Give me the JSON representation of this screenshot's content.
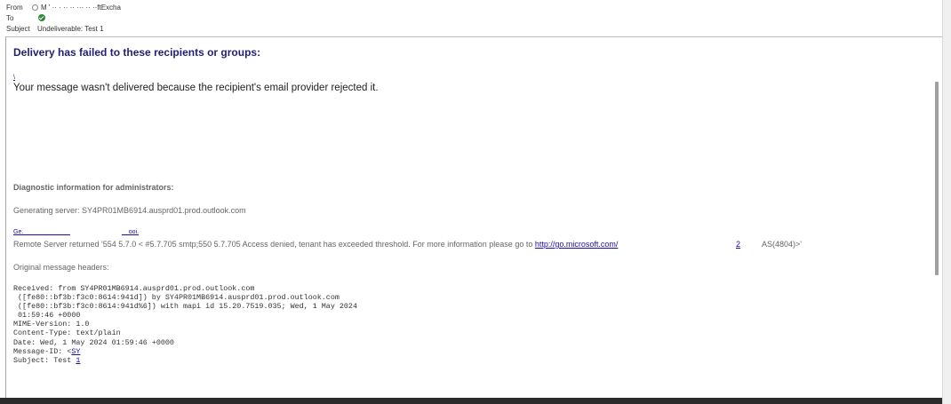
{
  "header": {
    "from_label": "From",
    "from_value": "M ' ·· · ·· ·· ··· ·· ··ftExcha",
    "to_label": "To",
    "subject_label": "Subject",
    "subject_value": "Undeliverable: Test 1"
  },
  "body": {
    "headline": "Delivery has failed to these recipients or groups:",
    "tiny_link": "\\",
    "message": "Your message wasn't delivered because the recipient's email provider rejected it.",
    "diag_title": "Diagnostic information for administrators:",
    "generating_server": "Generating server: SY4PR01MB6914.ausprd01.prod.outlook.com",
    "gen_link": "Ge.  _____________",
    "gen_link2": "__ooi.",
    "remote_prefix": "Remote Server returned '554 5.7.0 < #5.7.705 smtp;550 5.7.705 Access denied, tenant has exceeded threshold. For more information please go to ",
    "remote_link": "http://go.microsoft.com/",
    "remote_num": "2",
    "remote_suffix": "AS(4804)>'",
    "orig_headers_title": "Original message headers:",
    "headers_text": "Received: from SY4PR01MB6914.ausprd01.prod.outlook.com\n ([fe80::bf3b:f3c0:8614:941d]) by SY4PR01MB6914.ausprd01.prod.outlook.com\n ([fe80::bf3b:f3c0:8614:941d%6]) with mapi id 15.20.7519.035; Wed, 1 May 2024\n 01:59:46 +0000\nMIME-Version: 1.0\nContent-Type: text/plain\nDate: Wed, 1 May 2024 01:59:46 +0000",
    "message_id_label": "Message-ID: <",
    "message_id_link": "SY",
    "subject_line_prefix": "Subject: Test ",
    "subject_line_link": "1"
  }
}
